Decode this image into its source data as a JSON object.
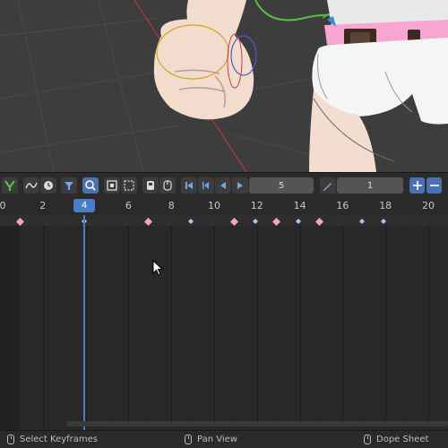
{
  "timeline": {
    "current_frame_badge": "4",
    "ruler_ticks": [
      {
        "label": "0",
        "frame": 0
      },
      {
        "label": "2",
        "frame": 2
      },
      {
        "label": "4",
        "frame": 4
      },
      {
        "label": "6",
        "frame": 6
      },
      {
        "label": "8",
        "frame": 8
      },
      {
        "label": "10",
        "frame": 10
      },
      {
        "label": "12",
        "frame": 12
      },
      {
        "label": "14",
        "frame": 14
      },
      {
        "label": "16",
        "frame": 16
      },
      {
        "label": "18",
        "frame": 18
      },
      {
        "label": "20",
        "frame": 20
      }
    ],
    "keyframes": [
      {
        "frame": 0,
        "kind": "selected"
      },
      {
        "frame": 3,
        "kind": "unselected"
      },
      {
        "frame": 6,
        "kind": "selected"
      },
      {
        "frame": 8,
        "kind": "unselected"
      },
      {
        "frame": 10,
        "kind": "selected"
      },
      {
        "frame": 11,
        "kind": "unselected"
      },
      {
        "frame": 12,
        "kind": "selected"
      },
      {
        "frame": 13,
        "kind": "unselected"
      },
      {
        "frame": 14,
        "kind": "selected"
      },
      {
        "frame": 16,
        "kind": "unselected"
      },
      {
        "frame": 17,
        "kind": "unselected"
      }
    ]
  },
  "toolbar": {
    "frame_field": "5",
    "step_field": "1"
  },
  "status": {
    "left": "Select Keyframes",
    "middle": "Pan View",
    "right": "Dope Sheet"
  },
  "colors": {
    "key_selected": "#f0a8b8",
    "key_unselected": "#a8c8e8",
    "playhead": "#4a7cc8",
    "accent_blue": "#4a72b0"
  },
  "icons": [
    "keyframe-insert-icon",
    "curve-icon",
    "clock-icon",
    "filter-icon",
    "zoom-icon",
    "frame-all-icon",
    "box-select-icon",
    "jump-start-icon",
    "prev-key-icon",
    "play-reverse-icon",
    "play-icon",
    "pencil-icon",
    "plus-icon",
    "minus-icon"
  ]
}
